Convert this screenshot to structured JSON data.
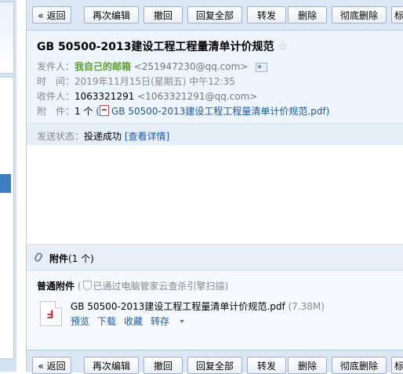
{
  "toolbar": {
    "back": "« 返回",
    "re_edit": "再次编辑",
    "recall": "撤回",
    "reply_all": "回复全部",
    "forward": "转发",
    "delete": "删除",
    "delete_permanently": "彻底删除",
    "more": "标"
  },
  "mail": {
    "subject": "GB 50500-2013建设工程工程量清单计价规范",
    "star": "☆",
    "sender_label": "发件人：",
    "sender_name": "我自己的邮箱",
    "sender_addr": "<251947230@qq.com>",
    "time_label": "时　间：",
    "time_value": "2019年11月15日(星期五) 中午12:35",
    "recipient_label": "收件人：",
    "recipient_name": "1063321291",
    "recipient_addr": "<1063321291@qq.com>",
    "attachment_label": "附　件：",
    "attachment_count": "1 个",
    "attachment_open": "(",
    "attachment_link": "GB 50500-2013建设工程工程量清单计价规范.pdf",
    "attachment_close": ")",
    "status_label": "发送状态：",
    "status_value": "投递成功",
    "status_detail": "[查看详情]"
  },
  "attachments": {
    "title": "附件",
    "count": "(1 个)",
    "normal_label": "普通附件",
    "scan_note_open": "(",
    "scan_note": "已通过电脑管家云查杀引擎扫描)",
    "file_name": "GB 50500-2013建设工程工程量清单计价规范.pdf",
    "file_size": "(7.38M)",
    "preview": "预览",
    "download": "下载",
    "save": "收藏",
    "save_to": "转存"
  }
}
